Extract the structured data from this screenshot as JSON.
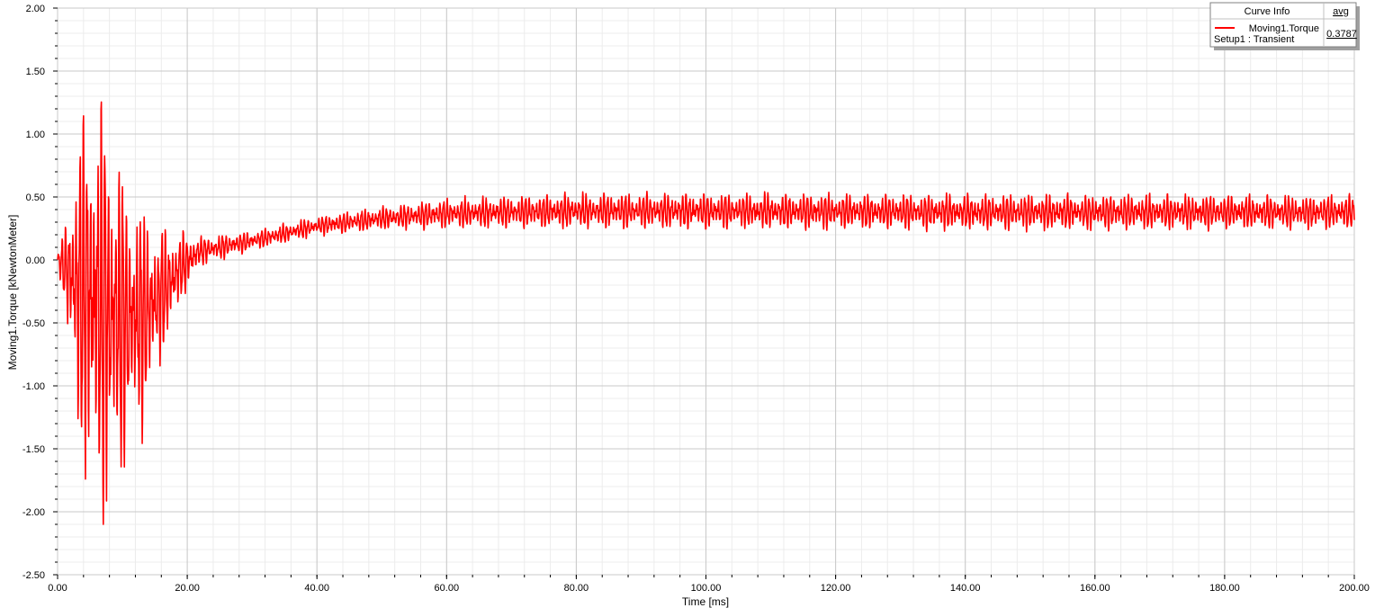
{
  "chart_data": {
    "type": "line",
    "xlabel": "Time [ms]",
    "ylabel": "Moving1.Torque [kNewtonMeter]",
    "xlim": [
      0,
      200
    ],
    "ylim": [
      -2.5,
      2.0
    ],
    "x_ticks": [
      "0.00",
      "20.00",
      "40.00",
      "60.00",
      "80.00",
      "100.00",
      "120.00",
      "140.00",
      "160.00",
      "180.00",
      "200.00"
    ],
    "y_ticks": [
      "2.00",
      "1.50",
      "1.00",
      "0.50",
      "0.00",
      "-0.50",
      "-1.00",
      "-1.50",
      "-2.00",
      "-2.50"
    ],
    "grid": true,
    "legend_placement": "top-right",
    "series": [
      {
        "name": "Moving1.Torque\nSetup1 : Transient",
        "color": "#ff0000",
        "envelope_keypoints": [
          {
            "t": 0,
            "mean": 0.0,
            "amp": 0.05
          },
          {
            "t": 1,
            "mean": -0.05,
            "amp": 0.3
          },
          {
            "t": 3,
            "mean": -0.2,
            "amp": 1.2
          },
          {
            "t": 5,
            "mean": -0.3,
            "amp": 1.75
          },
          {
            "t": 7,
            "mean": -0.4,
            "amp": 1.8
          },
          {
            "t": 9,
            "mean": -0.45,
            "amp": 1.55
          },
          {
            "t": 11,
            "mean": -0.5,
            "amp": 1.1
          },
          {
            "t": 13,
            "mean": -0.45,
            "amp": 0.95
          },
          {
            "t": 15,
            "mean": -0.35,
            "amp": 0.65
          },
          {
            "t": 17,
            "mean": -0.2,
            "amp": 0.45
          },
          {
            "t": 19,
            "mean": -0.05,
            "amp": 0.3
          },
          {
            "t": 22,
            "mean": 0.07,
            "amp": 0.12
          },
          {
            "t": 30,
            "mean": 0.15,
            "amp": 0.08
          },
          {
            "t": 40,
            "mean": 0.27,
            "amp": 0.08
          },
          {
            "t": 50,
            "mean": 0.33,
            "amp": 0.1
          },
          {
            "t": 60,
            "mean": 0.37,
            "amp": 0.12
          },
          {
            "t": 80,
            "mean": 0.39,
            "amp": 0.15
          },
          {
            "t": 100,
            "mean": 0.39,
            "amp": 0.15
          },
          {
            "t": 140,
            "mean": 0.38,
            "amp": 0.15
          },
          {
            "t": 170,
            "mean": 0.38,
            "amp": 0.15
          },
          {
            "t": 200,
            "mean": 0.38,
            "amp": 0.14
          }
        ]
      }
    ],
    "legend": {
      "header": "Curve Info",
      "stat_header": "avg",
      "line1": "Moving1.Torque",
      "line2": "Setup1 : Transient",
      "stat_value": "0.3787"
    }
  }
}
